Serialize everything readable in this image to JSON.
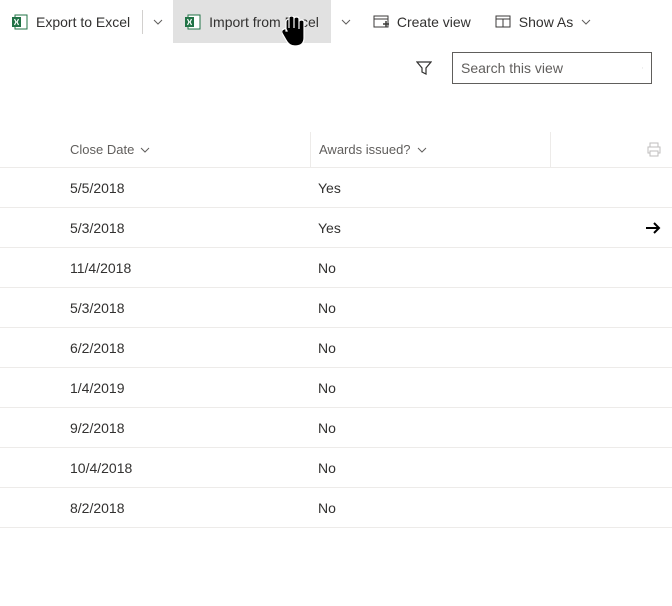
{
  "toolbar": {
    "export_label": "Export to Excel",
    "import_label": "Import from Excel",
    "create_view_label": "Create view",
    "show_as_label": "Show As"
  },
  "search": {
    "placeholder": "Search this view"
  },
  "columns": {
    "close_date": "Close Date",
    "awards_issued": "Awards issued?"
  },
  "rows": [
    {
      "close_date": "5/5/2018",
      "awards": "Yes",
      "arrow": false
    },
    {
      "close_date": "5/3/2018",
      "awards": "Yes",
      "arrow": true
    },
    {
      "close_date": "11/4/2018",
      "awards": "No",
      "arrow": false
    },
    {
      "close_date": "5/3/2018",
      "awards": "No",
      "arrow": false
    },
    {
      "close_date": "6/2/2018",
      "awards": "No",
      "arrow": false
    },
    {
      "close_date": "1/4/2019",
      "awards": "No",
      "arrow": false
    },
    {
      "close_date": "9/2/2018",
      "awards": "No",
      "arrow": false
    },
    {
      "close_date": "10/4/2018",
      "awards": "No",
      "arrow": false
    },
    {
      "close_date": "8/2/2018",
      "awards": "No",
      "arrow": false
    }
  ]
}
